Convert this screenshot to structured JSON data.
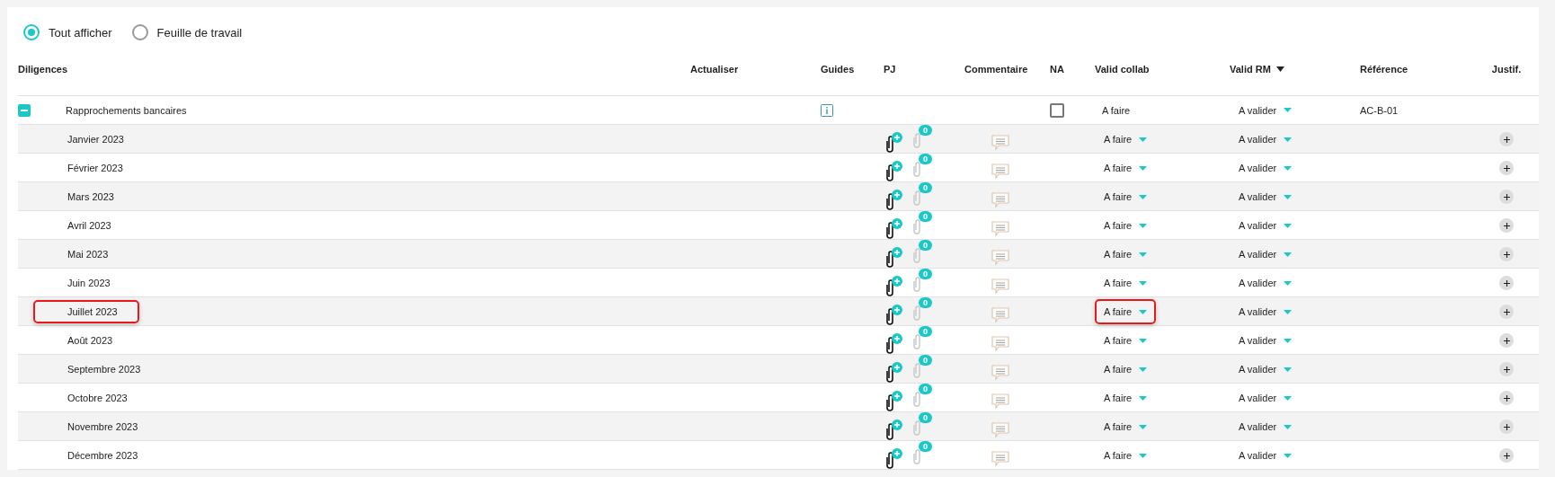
{
  "view_options": [
    {
      "label": "Tout afficher",
      "selected": true
    },
    {
      "label": "Feuille de travail",
      "selected": false
    }
  ],
  "table": {
    "columns": [
      {
        "label": "Diligences",
        "sorted": false
      },
      {
        "label": "Actualiser",
        "sorted": false
      },
      {
        "label": "Guides",
        "sorted": false
      },
      {
        "label": "PJ",
        "sorted": false
      },
      {
        "label": "Commentaire",
        "sorted": false
      },
      {
        "label": "NA",
        "sorted": false
      },
      {
        "label": "Valid collab",
        "sorted": false
      },
      {
        "label": "Valid RM",
        "sorted": true
      },
      {
        "label": "Référence",
        "sorted": false
      },
      {
        "label": "Justif.",
        "sorted": false
      }
    ],
    "group": {
      "name": "Rapprochements bancaires",
      "expanded": true,
      "na_checked": false,
      "valid_collab": {
        "value": "A faire",
        "dropdown": false
      },
      "valid_rm": {
        "value": "A valider",
        "dropdown": true
      },
      "reference": "AC-B-01"
    },
    "rows": [
      {
        "name": "Janvier 2023",
        "pj_count": "0",
        "valid_collab": "A faire",
        "valid_rm": "A valider",
        "highlighted": false,
        "collab_highlighted": false
      },
      {
        "name": "Février 2023",
        "pj_count": "0",
        "valid_collab": "A faire",
        "valid_rm": "A valider",
        "highlighted": false,
        "collab_highlighted": false
      },
      {
        "name": "Mars 2023",
        "pj_count": "0",
        "valid_collab": "A faire",
        "valid_rm": "A valider",
        "highlighted": false,
        "collab_highlighted": false
      },
      {
        "name": "Avril 2023",
        "pj_count": "0",
        "valid_collab": "A faire",
        "valid_rm": "A valider",
        "highlighted": false,
        "collab_highlighted": false
      },
      {
        "name": "Mai 2023",
        "pj_count": "0",
        "valid_collab": "A faire",
        "valid_rm": "A valider",
        "highlighted": false,
        "collab_highlighted": false
      },
      {
        "name": "Juin 2023",
        "pj_count": "0",
        "valid_collab": "A faire",
        "valid_rm": "A valider",
        "highlighted": false,
        "collab_highlighted": false
      },
      {
        "name": "Juillet 2023",
        "pj_count": "0",
        "valid_collab": "A faire",
        "valid_rm": "A valider",
        "highlighted": true,
        "collab_highlighted": true
      },
      {
        "name": "Août 2023",
        "pj_count": "0",
        "valid_collab": "A faire",
        "valid_rm": "A valider",
        "highlighted": false,
        "collab_highlighted": false
      },
      {
        "name": "Septembre 2023",
        "pj_count": "0",
        "valid_collab": "A faire",
        "valid_rm": "A valider",
        "highlighted": false,
        "collab_highlighted": false
      },
      {
        "name": "Octobre 2023",
        "pj_count": "0",
        "valid_collab": "A faire",
        "valid_rm": "A valider",
        "highlighted": false,
        "collab_highlighted": false
      },
      {
        "name": "Novembre 2023",
        "pj_count": "0",
        "valid_collab": "A faire",
        "valid_rm": "A valider",
        "highlighted": false,
        "collab_highlighted": false
      },
      {
        "name": "Décembre 2023",
        "pj_count": "0",
        "valid_collab": "A faire",
        "valid_rm": "A valider",
        "highlighted": false,
        "collab_highlighted": false
      }
    ]
  }
}
